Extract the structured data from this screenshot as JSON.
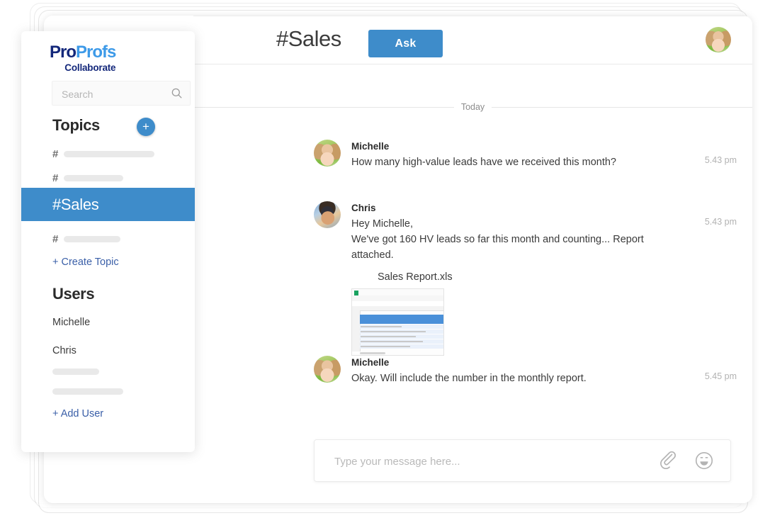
{
  "colors": {
    "accent_blue": "#3e8cca",
    "logo_navy": "#14287b",
    "logo_light_blue": "#3d9ae8",
    "link_blue": "#3a5fa8",
    "placeholder_grey": "#e9e9e9"
  },
  "sidebar": {
    "logo": {
      "pro": "Pro",
      "profs": "Profs",
      "sub": "Collaborate"
    },
    "search": {
      "value": "",
      "placeholder": "Search",
      "icon": "search-icon"
    },
    "topics_heading": "Topics",
    "add_topic_icon": "+",
    "topics": [
      {
        "hash": "#",
        "label": "",
        "placeholder_width": 128,
        "active": false
      },
      {
        "hash": "#",
        "label": "",
        "placeholder_width": 84,
        "active": false
      },
      {
        "hash": "",
        "label": "#Sales",
        "placeholder_width": 0,
        "active": true
      },
      {
        "hash": "#",
        "label": "",
        "placeholder_width": 80,
        "active": false
      }
    ],
    "create_topic_label": "+ Create Topic",
    "users_heading": "Users",
    "users": [
      {
        "name": "Michelle",
        "placeholder": false
      },
      {
        "name": "Chris",
        "placeholder": false
      },
      {
        "name": "",
        "placeholder": true,
        "placeholder_width": 66
      },
      {
        "name": "",
        "placeholder": true,
        "placeholder_width": 100
      }
    ],
    "add_user_label": "+ Add User"
  },
  "header": {
    "channel_title": "#Sales",
    "ask_label": "Ask",
    "avatar_name": "avatar"
  },
  "conversation": {
    "day_separator": "Today",
    "messages": [
      {
        "author": "Michelle",
        "avatar": "av-michelle",
        "lines": [
          "How many high-value leads have we received this month?"
        ],
        "time": "5.43 pm",
        "attachment": null
      },
      {
        "author": "Chris",
        "avatar": "av-chris",
        "lines": [
          "Hey Michelle,",
          "We've got 160 HV leads so far this month and counting... Report attached."
        ],
        "time": "5.43 pm",
        "attachment": {
          "filename": "Sales Report.xls",
          "thumb": "spreadsheet-thumbnail"
        }
      },
      {
        "author": "Michelle",
        "avatar": "av-michelle",
        "lines": [
          "Okay. Will include the number in the monthly report."
        ],
        "time": "5.45 pm",
        "attachment": null
      }
    ]
  },
  "composer": {
    "value": "",
    "placeholder": "Type your message here...",
    "attach_icon": "paperclip-icon",
    "emoji_icon": "smiley-icon"
  }
}
